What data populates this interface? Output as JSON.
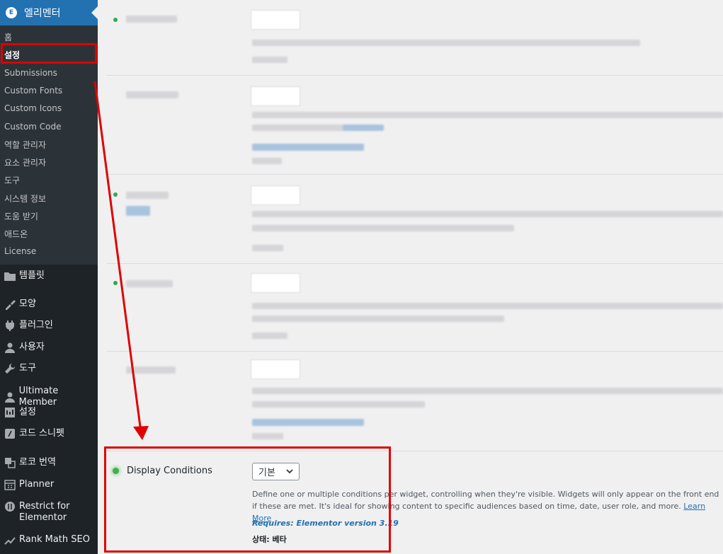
{
  "sidebar": {
    "top": {
      "label": "엘리멘터",
      "logo": "E"
    },
    "submenu": [
      "홈",
      "설정",
      "Submissions",
      "Custom Fonts",
      "Custom Icons",
      "Custom Code",
      "역할 관리자",
      "요소 관리자",
      "도구",
      "시스템 정보",
      "도움 받기",
      "애드온",
      "License"
    ],
    "menu": [
      {
        "label": "템플릿",
        "icon": "folder-icon"
      },
      {
        "label": "모양",
        "icon": "brush-icon"
      },
      {
        "label": "플러그인",
        "icon": "plug-icon"
      },
      {
        "label": "사용자",
        "icon": "user-icon"
      },
      {
        "label": "도구",
        "icon": "wrench-icon"
      },
      {
        "label": "Ultimate Member",
        "icon": "user-icon"
      },
      {
        "label": "설정",
        "icon": "settings-icon"
      },
      {
        "label": "코드 스니펫",
        "icon": "code-icon"
      },
      {
        "label": "로코 번역",
        "icon": "translate-icon"
      },
      {
        "label": "Planner",
        "icon": "calendar-icon"
      },
      {
        "label": "Restrict for Elementor",
        "icon": "shield-icon"
      },
      {
        "label": "Rank Math SEO",
        "icon": "chart-icon"
      }
    ]
  },
  "feature": {
    "title": "Display Conditions",
    "select_value": "기본",
    "description": "Define one or multiple conditions per widget, controlling when they're visible. Widgets will only appear on the front end if these are met. It's ideal for showing content to specific audiences based on time, date, user role, and more.",
    "learn_more": "Learn More",
    "requires": "Requires: Elementor version 3.19",
    "status": "상태: 베타"
  },
  "colors": {
    "accent": "#2271b1",
    "annotation": "#e00000",
    "sidebar_bg": "#1d2327",
    "submenu_bg": "#2c3338"
  }
}
